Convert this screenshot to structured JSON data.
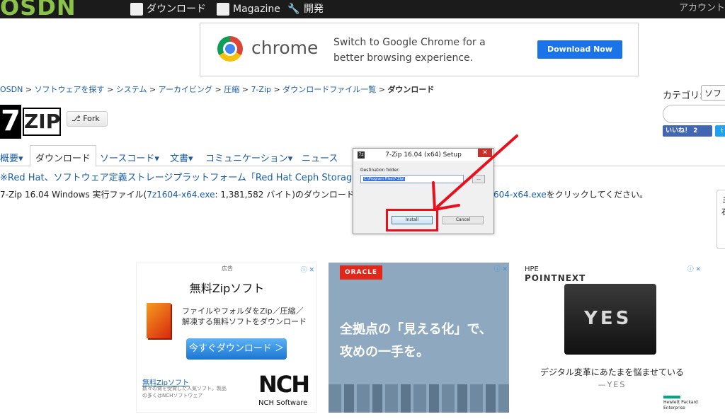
{
  "topbar": {
    "logo": "OSDN",
    "nav": [
      {
        "label": "ダウンロード",
        "icon": "download-icon"
      },
      {
        "label": "Magazine",
        "icon": "magazine-icon"
      },
      {
        "label": "開発",
        "icon": "wrench-icon"
      }
    ],
    "account": "アカウント"
  },
  "chrome_ad": {
    "brand": "chrome",
    "message": "Switch to Google Chrome for a better browsing experience.",
    "button": "Download Now"
  },
  "breadcrumb": {
    "items": [
      "OSDN",
      "ソフトウェアを探す",
      "システム",
      "アーカイビング",
      "圧縮",
      "7-Zip",
      "ダウンロードファイル一覧"
    ],
    "current": "ダウンロード",
    "separator": ">"
  },
  "sidebar": {
    "category_label": "カテゴリ:",
    "category_value": "ソフ",
    "like_label": "いいね！ 2",
    "side_box_text": "ミ 石"
  },
  "project": {
    "logo_seven": "7",
    "logo_zip": "ZIP",
    "fork_label": "Fork"
  },
  "tabs": [
    {
      "label": "概要▾"
    },
    {
      "label": "ダウンロード"
    },
    {
      "label": "ソースコード▾"
    },
    {
      "label": "文書▾"
    },
    {
      "label": "コミュニケーション▾"
    },
    {
      "label": "ニュース"
    }
  ],
  "notice": "※Red Hat、ソフトウェア定義ストレージプラットフォーム「Red Hat Ceph Storage 2.3」を",
  "description": {
    "prefix": "7-Zip 16.04 Windows 実行ファイル(",
    "file": "7z1604-x64.exe",
    "middle": ": 1,381,582 バイト)のダウンロードが開始",
    "link_tail": "604-x64.exe",
    "suffix": "をクリックしてください。"
  },
  "dialog": {
    "title": "7-Zip 16.04 (x64) Setup",
    "icon": "7z",
    "close": "✕",
    "folder_label": "Destination folder:",
    "path": "C:\\Program Files\\7-Zip\\",
    "browse": "...",
    "install": "Install",
    "cancel": "Cancel"
  },
  "ads": {
    "ad1": {
      "tag": "広告",
      "headline": "無料Zipソフト",
      "copy": "ファイルやフォルダをZip／圧縮／解凍する無料ソフトをダウンロード",
      "cta": "今すぐダウンロード ＞",
      "link": "無料Zipソフト",
      "small": "数々の賞を受賞した人気ソフト。製品の多くはNCHソフトウェア",
      "brand": "NCH",
      "brand_sub": "NCH Software"
    },
    "ad2": {
      "brand": "ORACLE",
      "line1": "全拠点の「見える化」で、",
      "line2": "攻めの一手を。"
    },
    "ad3": {
      "brand_small": "HPE",
      "brand": "POINTNEXT",
      "case_text": "YES",
      "caption": "デジタル変革にあたまを悩ませている",
      "sub": "—YES",
      "hpe": "Hewlett Packard Enterprise"
    },
    "ad_icons": "ⓘ ✕"
  },
  "colors": {
    "topbar": "#1b1b1b",
    "link": "#1a5ea8",
    "highlight": "#e8101d",
    "chrome_button": "#1a73e8"
  }
}
